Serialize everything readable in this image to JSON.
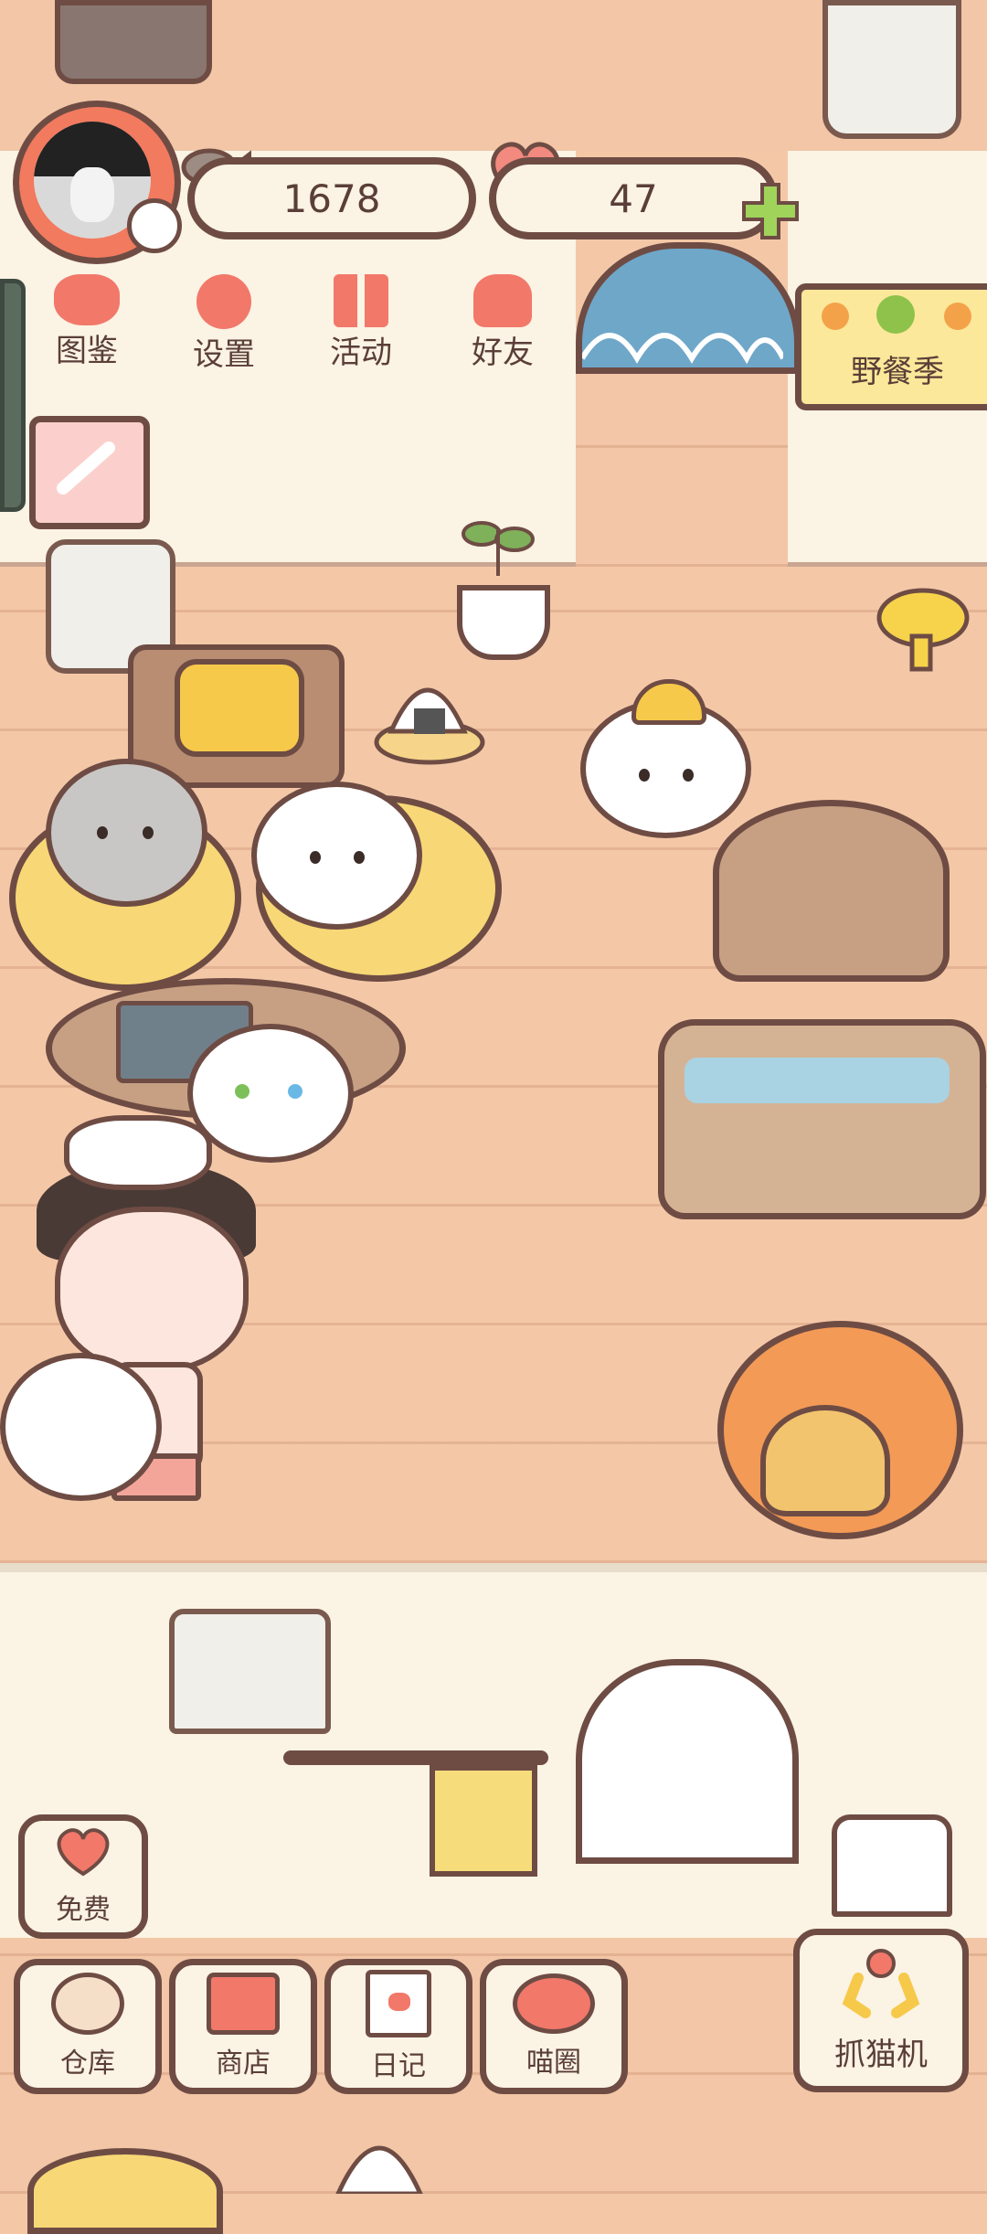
{
  "hud": {
    "coins": "1678",
    "hearts": "47"
  },
  "top_nav": [
    {
      "id": "catalog",
      "label": "图鉴"
    },
    {
      "id": "settings",
      "label": "设置"
    },
    {
      "id": "events",
      "label": "活动"
    },
    {
      "id": "friends",
      "label": "好友"
    }
  ],
  "season_sign": {
    "label": "野餐季"
  },
  "side_buttons": {
    "free_label": "免费"
  },
  "bottom_nav": [
    {
      "id": "storage",
      "label": "仓库"
    },
    {
      "id": "shop",
      "label": "商店"
    },
    {
      "id": "diary",
      "label": "日记"
    },
    {
      "id": "meow_circle",
      "label": "喵圈"
    }
  ],
  "claw_machine": {
    "label": "抓猫机"
  },
  "colors": {
    "accent": "#f2786a",
    "outline": "#6e4c44",
    "wall": "#fbf3e4",
    "floor": "#f4c8a7",
    "green_plus": "#9fd35a"
  }
}
